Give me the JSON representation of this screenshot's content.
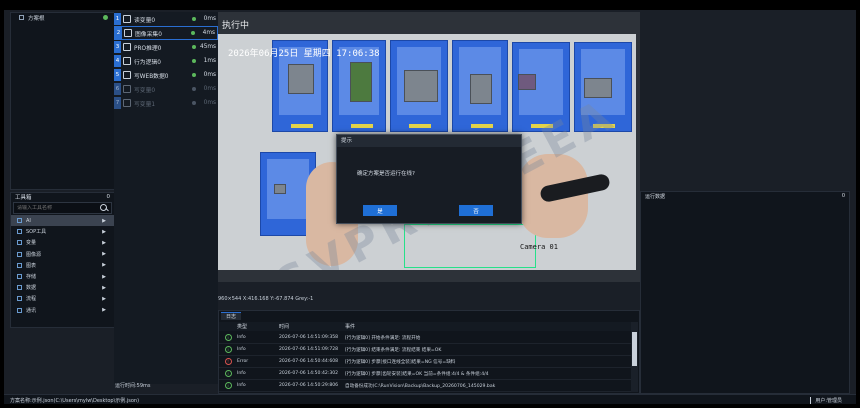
{
  "tree": {
    "root_label": "方案根"
  },
  "toolbox": {
    "title": "工具箱",
    "count": "0",
    "search_placeholder": "请输入工具名称",
    "items": [
      {
        "label": "AI"
      },
      {
        "label": "SOP工具"
      },
      {
        "label": "变量"
      },
      {
        "label": "图像源"
      },
      {
        "label": "图表"
      },
      {
        "label": "存储"
      },
      {
        "label": "数据"
      },
      {
        "label": "流程"
      },
      {
        "label": "通讯"
      }
    ]
  },
  "steps": [
    {
      "num": "1",
      "label": "读变量0",
      "ms": "0ms"
    },
    {
      "num": "2",
      "label": "图像采集0",
      "ms": "4ms"
    },
    {
      "num": "3",
      "label": "PRO推理0",
      "ms": "45ms"
    },
    {
      "num": "4",
      "label": "行为逻辑0",
      "ms": "1ms"
    },
    {
      "num": "5",
      "label": "写WEB数据0",
      "ms": "0ms"
    },
    {
      "num": "6",
      "label": "写变量0",
      "ms": "0ms"
    },
    {
      "num": "7",
      "label": "写变量1",
      "ms": "0ms"
    }
  ],
  "camera": {
    "paused_text": "执行中",
    "timestamp": "2026年06月25日 星期四 17:06:38",
    "camera_label": "Camera 01",
    "watermark": "SVPRFTTEEA",
    "status": "960×544 X:416.168 Y:-67.874 Grey:-1"
  },
  "dialog": {
    "title": "提示",
    "message": "确定方案是否运行在线?",
    "yes": "是",
    "no": "否"
  },
  "log": {
    "tab": "日志",
    "headers": {
      "type": "类型",
      "time": "时间",
      "event": "事件"
    },
    "rows": [
      {
        "type": "Info",
        "time": "2026-07-06 14:51:09:358",
        "event": "[行为逻辑0] 开始条件满足: 流程开始",
        "level": "info"
      },
      {
        "type": "Info",
        "time": "2026-07-06 14:51:09:728",
        "event": "[行为逻辑0] 结束条件满足: 流程结束 结果=OK",
        "level": "info"
      },
      {
        "type": "Error",
        "time": "2026-07-06 14:50:44:608",
        "event": "[行为逻辑0] 步骤[接口连线全装]结果=NG 信号=缺料",
        "level": "error"
      },
      {
        "type": "Info",
        "time": "2026-07-06 14:50:42:302",
        "event": "[行为逻辑0] 步骤[齿轮安装]结果=OK 当前=条件组:4/4 & 条件组:4/4",
        "level": "info"
      },
      {
        "type": "Info",
        "time": "2026-07-06 14:50:29:806",
        "event": "自动备份成功(C:\\RunVision\\Backup\\Backup_20260706_145029.bak",
        "level": "info"
      }
    ]
  },
  "run_panel": {
    "title": "运行数据",
    "count": "0"
  },
  "runtime": "运行时间:59ms",
  "statusbar": {
    "path": "方案名称:示例.json(C:\\Users\\mylw\\Desktop\\示例.json)",
    "user": "用户:管理员"
  }
}
